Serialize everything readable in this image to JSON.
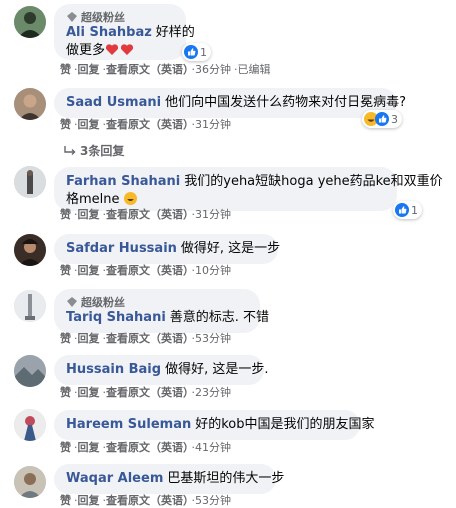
{
  "common": {
    "badge_label": "超级粉丝",
    "like": "赞",
    "reply": "回复",
    "see_original": "查看原文（英语）"
  },
  "comments": [
    {
      "name": "Ali Shahbaz",
      "text_line1": "好样的",
      "text_line2": "做更多",
      "badge": true,
      "time": "36分钟",
      "edited": "已编辑",
      "reaction_count": "1"
    },
    {
      "name": "Saad Usmani",
      "text_line1": "他们向中国发送什么药物来对付日冕病毒?",
      "time": "31分钟",
      "reaction_count": "3",
      "replies_label": "3条回复"
    },
    {
      "name": "Farhan Shahani",
      "text_line1": "我们的yeha短缺hoga yehe药品ke和双重价",
      "text_line2": "格melne",
      "time": "31分钟",
      "reaction_count": "1"
    },
    {
      "name": "Safdar Hussain",
      "text_line1": "做得好, 这是一步",
      "time": "10分钟"
    },
    {
      "name": "Tariq Shahani",
      "text_line1": "善意的标志. 不错",
      "badge": true,
      "time": "53分钟"
    },
    {
      "name": "Hussain Baig",
      "text_line1": "做得好, 这是一步.",
      "time": "23分钟"
    },
    {
      "name": "Hareem Suleman",
      "text_line1": "好的kob中国是我们的朋友国家",
      "time": "41分钟"
    },
    {
      "name": "Waqar Aleem",
      "text_line1": "巴基斯坦的伟大一步",
      "time": "53分钟"
    }
  ],
  "colors": {
    "bubble": "#f0f2f5",
    "name": "#385898",
    "meta": "#65676b",
    "like_blue": "#1877f2"
  }
}
